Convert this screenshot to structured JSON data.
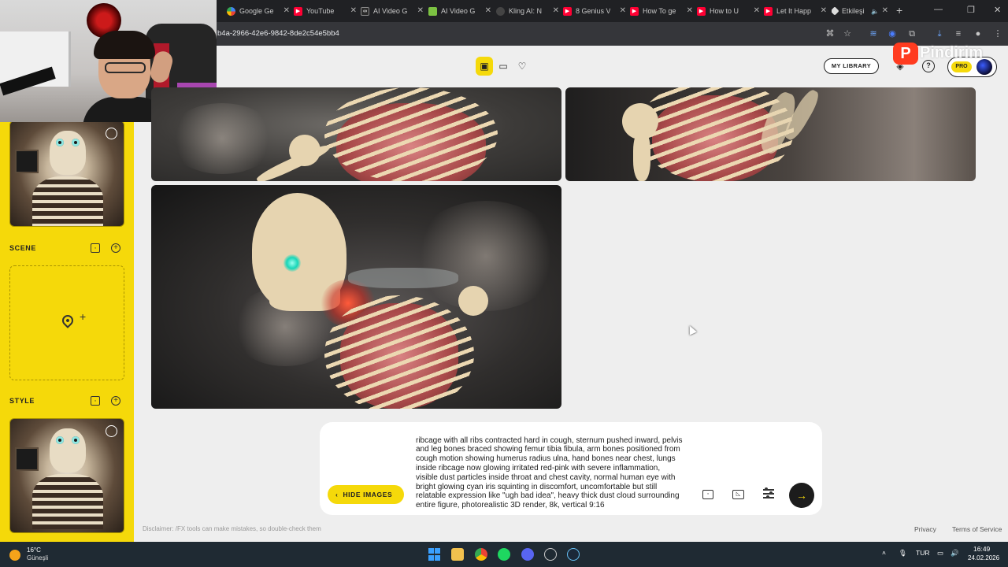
{
  "browser": {
    "tabs": [
      {
        "title": "Google Ge",
        "icon": "google-gemini-icon"
      },
      {
        "title": "YouTube",
        "icon": "youtube-icon"
      },
      {
        "title": "AI Video G",
        "icon": "infinity-icon"
      },
      {
        "title": "AI Video G",
        "icon": "green-app-icon"
      },
      {
        "title": "Kling AI: N",
        "icon": "kling-icon"
      },
      {
        "title": "8 Genius V",
        "icon": "youtube-icon"
      },
      {
        "title": "How To ge",
        "icon": "youtube-icon"
      },
      {
        "title": "How to U",
        "icon": "youtube-icon"
      },
      {
        "title": "Let It Happ",
        "icon": "youtube-icon"
      },
      {
        "title": "Etkileşi",
        "icon": "diamond-icon"
      }
    ],
    "url": "b4a-2966-42e6-9842-8de2c54e5bb4"
  },
  "sidebar": {
    "scene_label": "SCENE",
    "style_label": "STYLE"
  },
  "header": {
    "library_label": "MY LIBRARY",
    "help_label": "?",
    "pro_label": "PRO"
  },
  "watermark": {
    "letter": "P",
    "text": "Pindirim"
  },
  "prompt": {
    "text": "ribcage with all ribs contracted hard in cough, sternum pushed inward, pelvis and leg bones braced showing femur tibia fibula, arm bones positioned from cough motion showing humerus radius ulna, hand bones near chest, lungs inside ribcage now glowing irritated red-pink with severe inflammation, visible dust particles inside throat and chest cavity, normal human eye with bright glowing cyan iris squinting in discomfort, uncomfortable but still relatable expression like \"ugh bad idea\", heavy thick dust cloud surrounding entire figure, photorealistic 3D render, 8k, vertical 9:16",
    "hide_images_label": "HIDE IMAGES"
  },
  "footer": {
    "disclaimer": "Disclaimer: /FX tools can make mistakes, so double-check them",
    "privacy": "Privacy",
    "terms": "Terms of Service"
  },
  "taskbar": {
    "temperature": "16°C",
    "weather": "Güneşli",
    "language": "TUR",
    "time": "16:49",
    "date": "24.02.2026"
  },
  "colors": {
    "accent_yellow": "#f5d90a",
    "page_bg": "#eeeeee",
    "chrome_dark": "#202124",
    "send_button": "#1c1c1c"
  }
}
